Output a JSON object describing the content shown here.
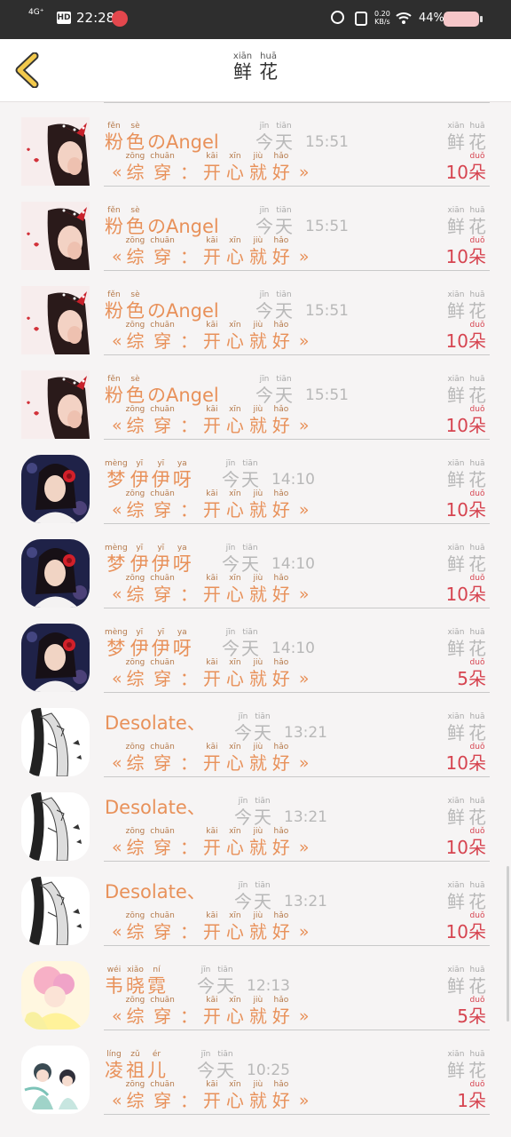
{
  "status_bar": {
    "network": "4G⁺",
    "hd": "HD",
    "time": "22:28",
    "net_speed": "0.20\nKB/s",
    "battery": "44%",
    "icons": [
      "signal-icon",
      "hd-icon",
      "app-notification-icon",
      "alarm-icon",
      "vibrate-icon",
      "wifi-icon",
      "battery-icon"
    ]
  },
  "header": {
    "title_chars": [
      {
        "py": "xiān",
        "ch": "鲜"
      },
      {
        "py": "huā",
        "ch": "花"
      }
    ],
    "back_icon": "chevron-left-icon",
    "back_color": "#f2c94c"
  },
  "common": {
    "today": [
      {
        "py": "jīn",
        "ch": "今"
      },
      {
        "py": "tiān",
        "ch": "天"
      }
    ],
    "message": {
      "open": "«",
      "chars": [
        {
          "py": "zōng",
          "ch": "综"
        },
        {
          "py": "chuān",
          "ch": "穿"
        },
        {
          "py": "",
          "ch": "："
        },
        {
          "py": "kāi",
          "ch": "开"
        },
        {
          "py": "xīn",
          "ch": "心"
        },
        {
          "py": "jiù",
          "ch": "就"
        },
        {
          "py": "hǎo",
          "ch": "好"
        }
      ],
      "close": "»"
    },
    "flower": [
      {
        "py": "xiān",
        "ch": "鲜"
      },
      {
        "py": "huā",
        "ch": "花"
      }
    ],
    "unit": {
      "py": "duǒ",
      "ch": "朵"
    }
  },
  "rows": [
    {
      "avatar": "girl-red-bow",
      "shape": "square",
      "name_chars": [
        {
          "py": "fěn",
          "ch": "粉"
        },
        {
          "py": "sè",
          "ch": "色"
        }
      ],
      "name_latin": "のAngel",
      "time": "15:51",
      "count": "10"
    },
    {
      "avatar": "girl-red-bow",
      "shape": "square",
      "name_chars": [
        {
          "py": "fěn",
          "ch": "粉"
        },
        {
          "py": "sè",
          "ch": "色"
        }
      ],
      "name_latin": "のAngel",
      "time": "15:51",
      "count": "10"
    },
    {
      "avatar": "girl-red-bow",
      "shape": "square",
      "name_chars": [
        {
          "py": "fěn",
          "ch": "粉"
        },
        {
          "py": "sè",
          "ch": "色"
        }
      ],
      "name_latin": "のAngel",
      "time": "15:51",
      "count": "10"
    },
    {
      "avatar": "girl-red-bow",
      "shape": "square",
      "name_chars": [
        {
          "py": "fěn",
          "ch": "粉"
        },
        {
          "py": "sè",
          "ch": "色"
        }
      ],
      "name_latin": "のAngel",
      "time": "15:51",
      "count": "10"
    },
    {
      "avatar": "woman-red-flower",
      "shape": "round",
      "name_chars": [
        {
          "py": "mèng",
          "ch": "梦"
        },
        {
          "py": "yī",
          "ch": "伊"
        },
        {
          "py": "yī",
          "ch": "伊"
        },
        {
          "py": "ya",
          "ch": "呀"
        }
      ],
      "name_latin": "",
      "time": "14:10",
      "count": "10"
    },
    {
      "avatar": "woman-red-flower",
      "shape": "round",
      "name_chars": [
        {
          "py": "mèng",
          "ch": "梦"
        },
        {
          "py": "yī",
          "ch": "伊"
        },
        {
          "py": "yī",
          "ch": "伊"
        },
        {
          "py": "ya",
          "ch": "呀"
        }
      ],
      "name_latin": "",
      "time": "14:10",
      "count": "10"
    },
    {
      "avatar": "woman-red-flower",
      "shape": "round",
      "name_chars": [
        {
          "py": "mèng",
          "ch": "梦"
        },
        {
          "py": "yī",
          "ch": "伊"
        },
        {
          "py": "yī",
          "ch": "伊"
        },
        {
          "py": "ya",
          "ch": "呀"
        }
      ],
      "name_latin": "",
      "time": "14:10",
      "count": "5"
    },
    {
      "avatar": "manga-sketch",
      "shape": "round",
      "name_chars": [],
      "name_latin": "Desolate、",
      "time": "13:21",
      "count": "10"
    },
    {
      "avatar": "manga-sketch",
      "shape": "round",
      "name_chars": [],
      "name_latin": "Desolate、",
      "time": "13:21",
      "count": "10"
    },
    {
      "avatar": "manga-sketch",
      "shape": "round",
      "name_chars": [],
      "name_latin": "Desolate、",
      "time": "13:21",
      "count": "10"
    },
    {
      "avatar": "anime-pastel",
      "shape": "round",
      "name_chars": [
        {
          "py": "wéi",
          "ch": "韦"
        },
        {
          "py": "xiǎo",
          "ch": "晓"
        },
        {
          "py": "ní",
          "ch": "霓"
        }
      ],
      "name_latin": "",
      "time": "12:13",
      "count": "5"
    },
    {
      "avatar": "anime-chibi",
      "shape": "round",
      "name_chars": [
        {
          "py": "líng",
          "ch": "凌"
        },
        {
          "py": "zǔ",
          "ch": "祖"
        },
        {
          "py": "ér",
          "ch": "儿"
        }
      ],
      "name_latin": "",
      "time": "10:25",
      "count": "1"
    }
  ]
}
